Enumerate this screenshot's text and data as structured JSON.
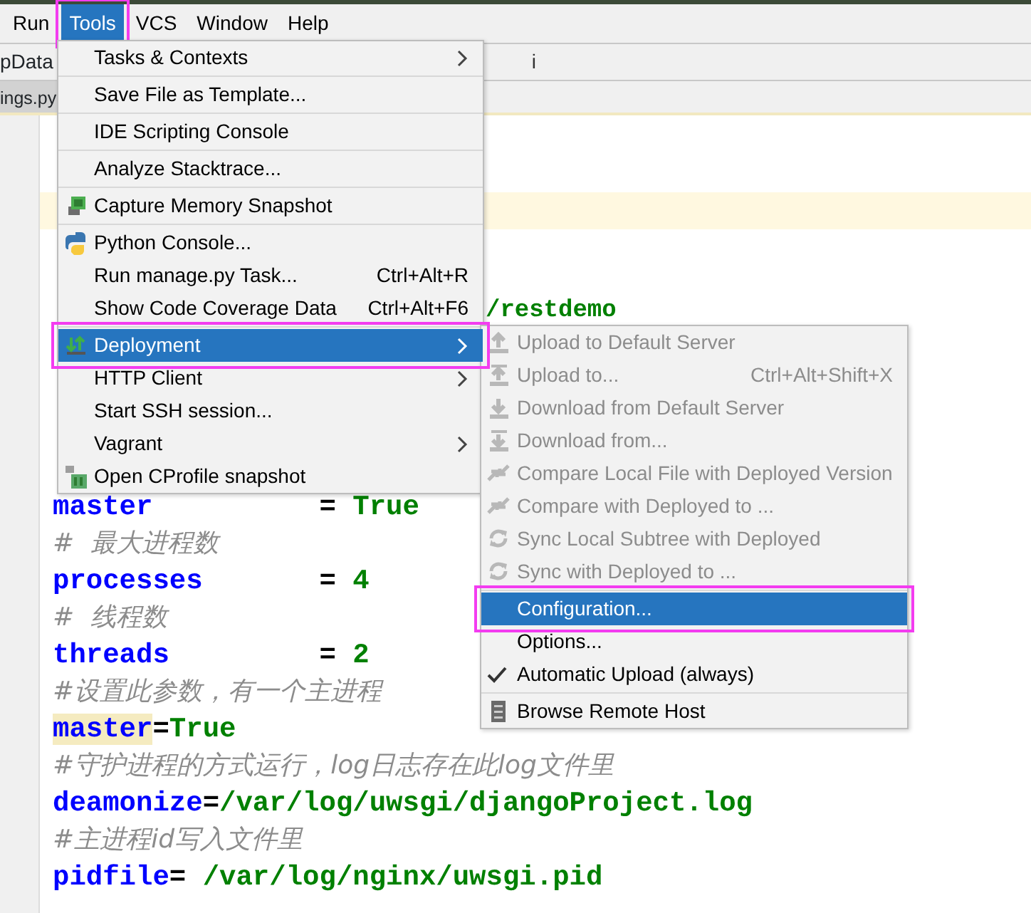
{
  "menubar": [
    {
      "label": "Run",
      "selected": false,
      "annotated": false
    },
    {
      "label": "Tools",
      "selected": true,
      "annotated": true
    },
    {
      "label": "VCS",
      "selected": false,
      "annotated": false
    },
    {
      "label": "Window",
      "selected": false,
      "annotated": false
    },
    {
      "label": "Help",
      "selected": false,
      "annotated": false
    }
  ],
  "breadcrumbs": [
    "pData",
    "i"
  ],
  "editor_tab": {
    "label": "ings.py"
  },
  "code_lines": [
    {
      "kind": "code",
      "segments": [
        {
          "text": "/restdemo",
          "highlighted": false
        }
      ]
    },
    {
      "kind": "code",
      "segments": [
        {
          "text": "master",
          "highlighted": false
        },
        {
          "text": "          = ",
          "highlighted": false
        },
        {
          "text": "True",
          "highlighted": false
        }
      ]
    },
    {
      "kind": "comment",
      "text": "#  最大进程数"
    },
    {
      "kind": "code",
      "segments": [
        {
          "text": "processes",
          "highlighted": false
        },
        {
          "text": "       = ",
          "highlighted": false
        },
        {
          "text": "4",
          "highlighted": false
        }
      ]
    },
    {
      "kind": "comment",
      "text": "#  线程数"
    },
    {
      "kind": "code",
      "segments": [
        {
          "text": "threads",
          "highlighted": false
        },
        {
          "text": "         = ",
          "highlighted": false
        },
        {
          "text": "2",
          "highlighted": false
        }
      ]
    },
    {
      "kind": "comment",
      "text": "#设置此参数，有一个主进程"
    },
    {
      "kind": "code",
      "segments": [
        {
          "text": "master",
          "highlighted": true
        },
        {
          "text": "=",
          "highlighted": false
        },
        {
          "text": "True",
          "highlighted": false
        }
      ]
    },
    {
      "kind": "comment",
      "text": "#守护进程的方式运行，log日志存在此log文件里"
    },
    {
      "kind": "code",
      "segments": [
        {
          "text": "deamonize",
          "highlighted": false
        },
        {
          "text": "=",
          "highlighted": false
        },
        {
          "text": "/var/log/uwsgi/djangoProject.log",
          "highlighted": false
        }
      ]
    },
    {
      "kind": "comment",
      "text": "#主进程id写入文件里"
    },
    {
      "kind": "code",
      "segments": [
        {
          "text": "pidfile",
          "highlighted": false
        },
        {
          "text": "= ",
          "highlighted": false
        },
        {
          "text": "/var/log/nginx/uwsgi.pid",
          "highlighted": false
        }
      ]
    }
  ],
  "tools_menu": [
    {
      "kind": "item",
      "label": "Tasks & Contexts",
      "submenu": true,
      "selected": false,
      "annotated": false
    },
    {
      "kind": "separator"
    },
    {
      "kind": "item",
      "label": "Save File as Template...",
      "submenu": false,
      "selected": false,
      "annotated": false
    },
    {
      "kind": "separator"
    },
    {
      "kind": "item",
      "label": "IDE Scripting Console",
      "submenu": false,
      "selected": false,
      "annotated": false
    },
    {
      "kind": "separator"
    },
    {
      "kind": "item",
      "label": "Analyze Stacktrace...",
      "submenu": false,
      "selected": false,
      "annotated": false
    },
    {
      "kind": "separator"
    },
    {
      "kind": "item",
      "label": "Capture Memory Snapshot",
      "submenu": false,
      "selected": false,
      "annotated": false
    },
    {
      "kind": "separator"
    },
    {
      "kind": "item",
      "label": "Python Console...",
      "submenu": false,
      "selected": false,
      "annotated": false
    },
    {
      "kind": "item",
      "label": "Run manage.py Task...",
      "shortcut": "Ctrl+Alt+R",
      "submenu": false,
      "selected": false,
      "annotated": false
    },
    {
      "kind": "item",
      "label": "Show Code Coverage Data",
      "shortcut": "Ctrl+Alt+F6",
      "submenu": false,
      "selected": false,
      "annotated": false
    },
    {
      "kind": "separator"
    },
    {
      "kind": "item",
      "label": "Deployment",
      "submenu": true,
      "selected": true,
      "annotated": true
    },
    {
      "kind": "item",
      "label": "HTTP Client",
      "submenu": true,
      "selected": false,
      "annotated": false
    },
    {
      "kind": "item",
      "label": "Start SSH session...",
      "submenu": false,
      "selected": false,
      "annotated": false
    },
    {
      "kind": "item",
      "label": "Vagrant",
      "submenu": true,
      "selected": false,
      "annotated": false
    },
    {
      "kind": "item",
      "label": "Open CProfile snapshot",
      "submenu": false,
      "selected": false,
      "annotated": false
    }
  ],
  "deployment_menu": [
    {
      "kind": "item",
      "label": "Upload to Default Server",
      "disabled": true,
      "selected": false,
      "checked": false,
      "annotated": false
    },
    {
      "kind": "item",
      "label": "Upload to...",
      "shortcut": "Ctrl+Alt+Shift+X",
      "disabled": true,
      "selected": false,
      "checked": false,
      "annotated": false
    },
    {
      "kind": "item",
      "label": "Download from Default Server",
      "disabled": true,
      "selected": false,
      "checked": false,
      "annotated": false
    },
    {
      "kind": "item",
      "label": "Download from...",
      "disabled": true,
      "selected": false,
      "checked": false,
      "annotated": false
    },
    {
      "kind": "item",
      "label": "Compare Local File with Deployed Version",
      "disabled": true,
      "selected": false,
      "checked": false,
      "annotated": false
    },
    {
      "kind": "item",
      "label": "Compare with Deployed to ...",
      "disabled": true,
      "selected": false,
      "checked": false,
      "annotated": false
    },
    {
      "kind": "item",
      "label": "Sync Local Subtree with Deployed",
      "disabled": true,
      "selected": false,
      "checked": false,
      "annotated": false
    },
    {
      "kind": "item",
      "label": "Sync with Deployed to ...",
      "disabled": true,
      "selected": false,
      "checked": false,
      "annotated": false
    },
    {
      "kind": "separator"
    },
    {
      "kind": "item",
      "label": "Configuration...",
      "disabled": false,
      "selected": true,
      "checked": false,
      "annotated": true
    },
    {
      "kind": "item",
      "label": "Options...",
      "disabled": false,
      "selected": false,
      "checked": false,
      "annotated": false
    },
    {
      "kind": "item",
      "label": "Automatic Upload (always)",
      "disabled": false,
      "selected": false,
      "checked": true,
      "annotated": false
    },
    {
      "kind": "separator"
    },
    {
      "kind": "item",
      "label": "Browse Remote Host",
      "disabled": false,
      "selected": false,
      "checked": false,
      "annotated": false
    }
  ]
}
